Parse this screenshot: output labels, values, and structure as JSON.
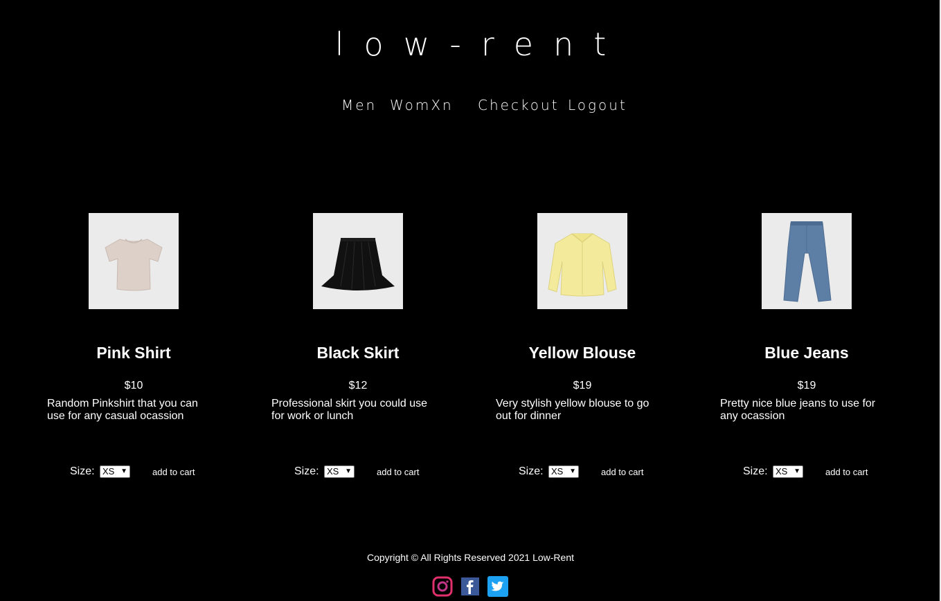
{
  "header": {
    "logo": "low-rent"
  },
  "nav": {
    "men": "Men",
    "womxn": "WomXn",
    "checkout": "Checkout",
    "logout": "Logout"
  },
  "products": [
    {
      "name": "Pink Shirt",
      "price": "$10",
      "description": "Random Pinkshirt that you can use for any casual ocassion",
      "size_label": "Size:",
      "size_value": "XS",
      "cart_label": "add to cart",
      "image": "pink-shirt-image"
    },
    {
      "name": "Black Skirt",
      "price": "$12",
      "description": "Professional skirt you could use for work or lunch",
      "size_label": "Size:",
      "size_value": "XS",
      "cart_label": "add to cart",
      "image": "black-skirt-image"
    },
    {
      "name": "Yellow Blouse",
      "price": "$19",
      "description": "Very stylish yellow blouse to go out for dinner",
      "size_label": "Size:",
      "size_value": "XS",
      "cart_label": "add to cart",
      "image": "yellow-blouse-image"
    },
    {
      "name": "Blue Jeans",
      "price": "$19",
      "description": "Pretty nice blue jeans to use for any ocassion",
      "size_label": "Size:",
      "size_value": "XS",
      "cart_label": "add to cart",
      "image": "blue-jeans-image"
    }
  ],
  "footer": {
    "copyright": "Copyright © All Rights Reserved 2021 Low-Rent",
    "social": [
      "instagram-icon",
      "facebook-icon",
      "twitter-icon"
    ]
  },
  "colors": {
    "background": "#000000",
    "text": "#ffffff",
    "image_bg": "#ebebeb",
    "instagram": "#e1306c",
    "facebook": "#3b5998",
    "twitter": "#1da1f2"
  }
}
